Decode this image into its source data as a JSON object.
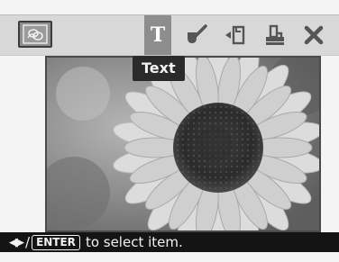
{
  "toolbar": {
    "thumbnail_icon": "image-thumbnail-icon",
    "tools": [
      {
        "icon": "text-icon",
        "glyph": "T",
        "selected": true
      },
      {
        "icon": "brush-icon",
        "selected": false
      },
      {
        "icon": "rotate-frame-icon",
        "selected": false
      },
      {
        "icon": "print-icon",
        "selected": false
      },
      {
        "icon": "close-icon",
        "selected": false
      }
    ]
  },
  "tooltip": {
    "text": "Text"
  },
  "photo": {
    "subject": "sunflower-photo"
  },
  "footer": {
    "enter_key": "ENTER",
    "hint": "to select item."
  }
}
